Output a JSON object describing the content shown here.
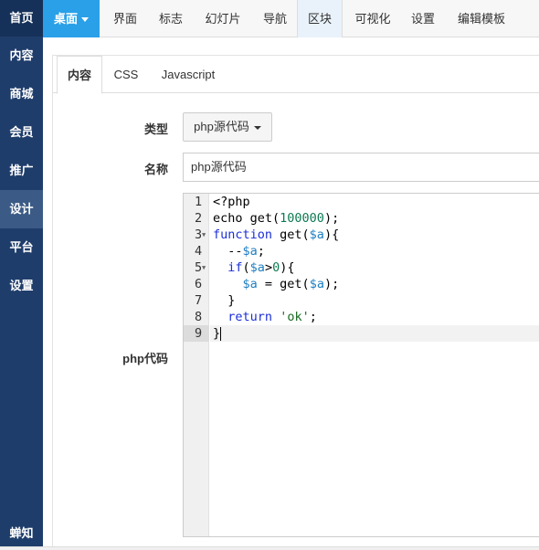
{
  "sidebar": {
    "home": "首页",
    "items": [
      {
        "label": "内容",
        "active": false
      },
      {
        "label": "商城",
        "active": false
      },
      {
        "label": "会员",
        "active": false
      },
      {
        "label": "推广",
        "active": false
      },
      {
        "label": "设计",
        "active": true
      },
      {
        "label": "平台",
        "active": false
      },
      {
        "label": "设置",
        "active": false
      }
    ],
    "brand": "蝉知"
  },
  "topnav": {
    "desk": "桌面",
    "tabs": [
      {
        "label": "界面",
        "active": false
      },
      {
        "label": "标志",
        "active": false
      },
      {
        "label": "幻灯片",
        "active": false
      },
      {
        "label": "导航",
        "active": false
      },
      {
        "label": "区块",
        "active": true
      },
      {
        "label": "可视化",
        "active": false
      },
      {
        "label": "设置",
        "active": false
      },
      {
        "label": "编辑模板",
        "active": false
      }
    ]
  },
  "subtabs": [
    {
      "label": "内容",
      "active": true
    },
    {
      "label": "CSS",
      "active": false
    },
    {
      "label": "Javascript",
      "active": false
    }
  ],
  "form": {
    "type_label": "类型",
    "type_value": "php源代码",
    "name_label": "名称",
    "name_value": "php源代码",
    "code_label": "php代码"
  },
  "editor": {
    "lines": [
      {
        "n": "1",
        "text": "<?php"
      },
      {
        "n": "2",
        "text": "echo get(100000);"
      },
      {
        "n": "3",
        "text": "function get($a){"
      },
      {
        "n": "4",
        "text": "  --$a;"
      },
      {
        "n": "5",
        "text": "  if($a>0){"
      },
      {
        "n": "6",
        "text": "    $a = get($a);"
      },
      {
        "n": "7",
        "text": "  }"
      },
      {
        "n": "8",
        "text": "  return 'ok';"
      },
      {
        "n": "9",
        "text": "}"
      }
    ],
    "active_line": 9,
    "fold_lines": [
      3,
      5
    ]
  }
}
